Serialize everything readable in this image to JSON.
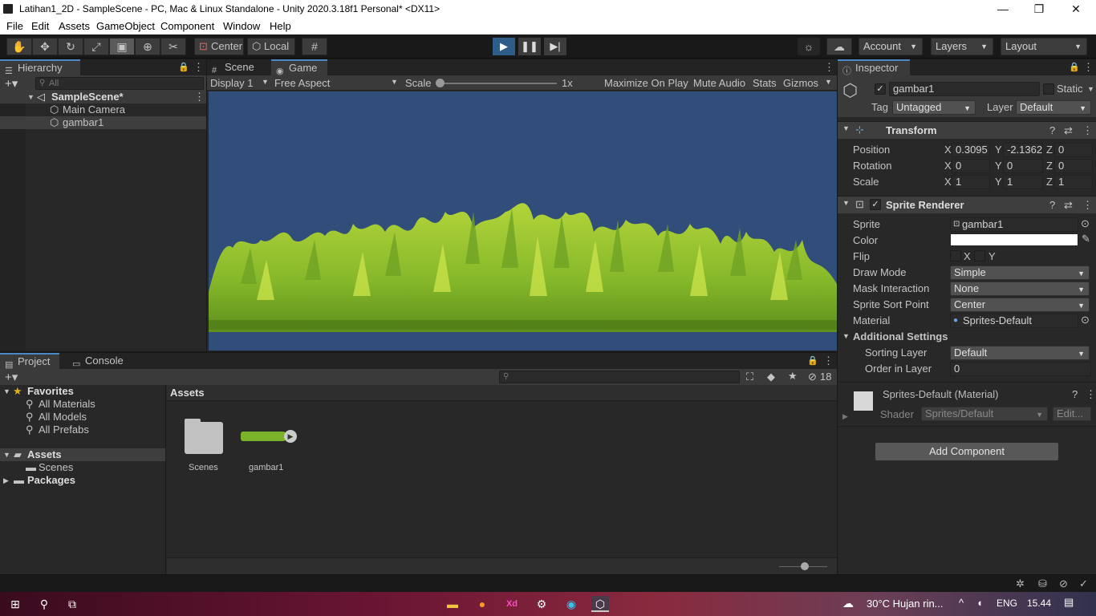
{
  "window": {
    "title": "Latihan1_2D - SampleScene - PC, Mac & Linux Standalone - Unity 2020.3.18f1 Personal* <DX11>",
    "minimize": "—",
    "maximize": "❐",
    "close": "✕"
  },
  "menu": [
    "File",
    "Edit",
    "Assets",
    "GameObject",
    "Component",
    "Window",
    "Help"
  ],
  "toolbar": {
    "pivot": "Center",
    "space": "Local",
    "account": "Account",
    "layers": "Layers",
    "layout": "Layout"
  },
  "hierarchy": {
    "tab": "Hierarchy",
    "search_placeholder": "All",
    "scene": "SampleScene*",
    "items": [
      "Main Camera",
      "gambar1"
    ]
  },
  "game": {
    "tabs": [
      "Scene",
      "Game"
    ],
    "display": "Display 1",
    "aspect": "Free Aspect",
    "scale_label": "Scale",
    "scale_value": "1x",
    "buttons": [
      "Maximize On Play",
      "Mute Audio",
      "Stats",
      "Gizmos"
    ],
    "bg_color": "#314d79"
  },
  "project": {
    "tabs": [
      "Project",
      "Console"
    ],
    "hidden_count": "18",
    "breadcrumb": "Assets",
    "favorites_label": "Favorites",
    "favorites": [
      "All Materials",
      "All Models",
      "All Prefabs"
    ],
    "assets_label": "Assets",
    "assets_children": [
      "Scenes"
    ],
    "packages_label": "Packages",
    "grid_items": [
      "Scenes",
      "gambar1"
    ]
  },
  "inspector": {
    "tab": "Inspector",
    "object_name": "gambar1",
    "static_label": "Static",
    "tag_label": "Tag",
    "tag_value": "Untagged",
    "layer_label": "Layer",
    "layer_value": "Default",
    "transform": {
      "title": "Transform",
      "position_label": "Position",
      "pos": [
        "0.3095",
        "-2.1362",
        "0"
      ],
      "rotation_label": "Rotation",
      "rot": [
        "0",
        "0",
        "0"
      ],
      "scale_label": "Scale",
      "scl": [
        "1",
        "1",
        "1"
      ],
      "axes": [
        "X",
        "Y",
        "Z"
      ]
    },
    "sprite_renderer": {
      "title": "Sprite Renderer",
      "sprite_label": "Sprite",
      "sprite": "gambar1",
      "color_label": "Color",
      "flip_label": "Flip",
      "flip_x": "X",
      "flip_y": "Y",
      "draw_mode_label": "Draw Mode",
      "draw_mode": "Simple",
      "mask_label": "Mask Interaction",
      "mask": "None",
      "sort_point_label": "Sprite Sort Point",
      "sort_point": "Center",
      "material_label": "Material",
      "material": "Sprites-Default",
      "additional_label": "Additional Settings",
      "sorting_layer_label": "Sorting Layer",
      "sorting_layer": "Default",
      "order_label": "Order in Layer",
      "order": "0"
    },
    "material_block": {
      "title": "Sprites-Default (Material)",
      "shader_label": "Shader",
      "shader": "Sprites/Default",
      "edit": "Edit..."
    },
    "add_component": "Add Component"
  },
  "taskbar": {
    "weather": "30°C  Hujan rin...",
    "lang": "ENG",
    "time": "15.44"
  }
}
